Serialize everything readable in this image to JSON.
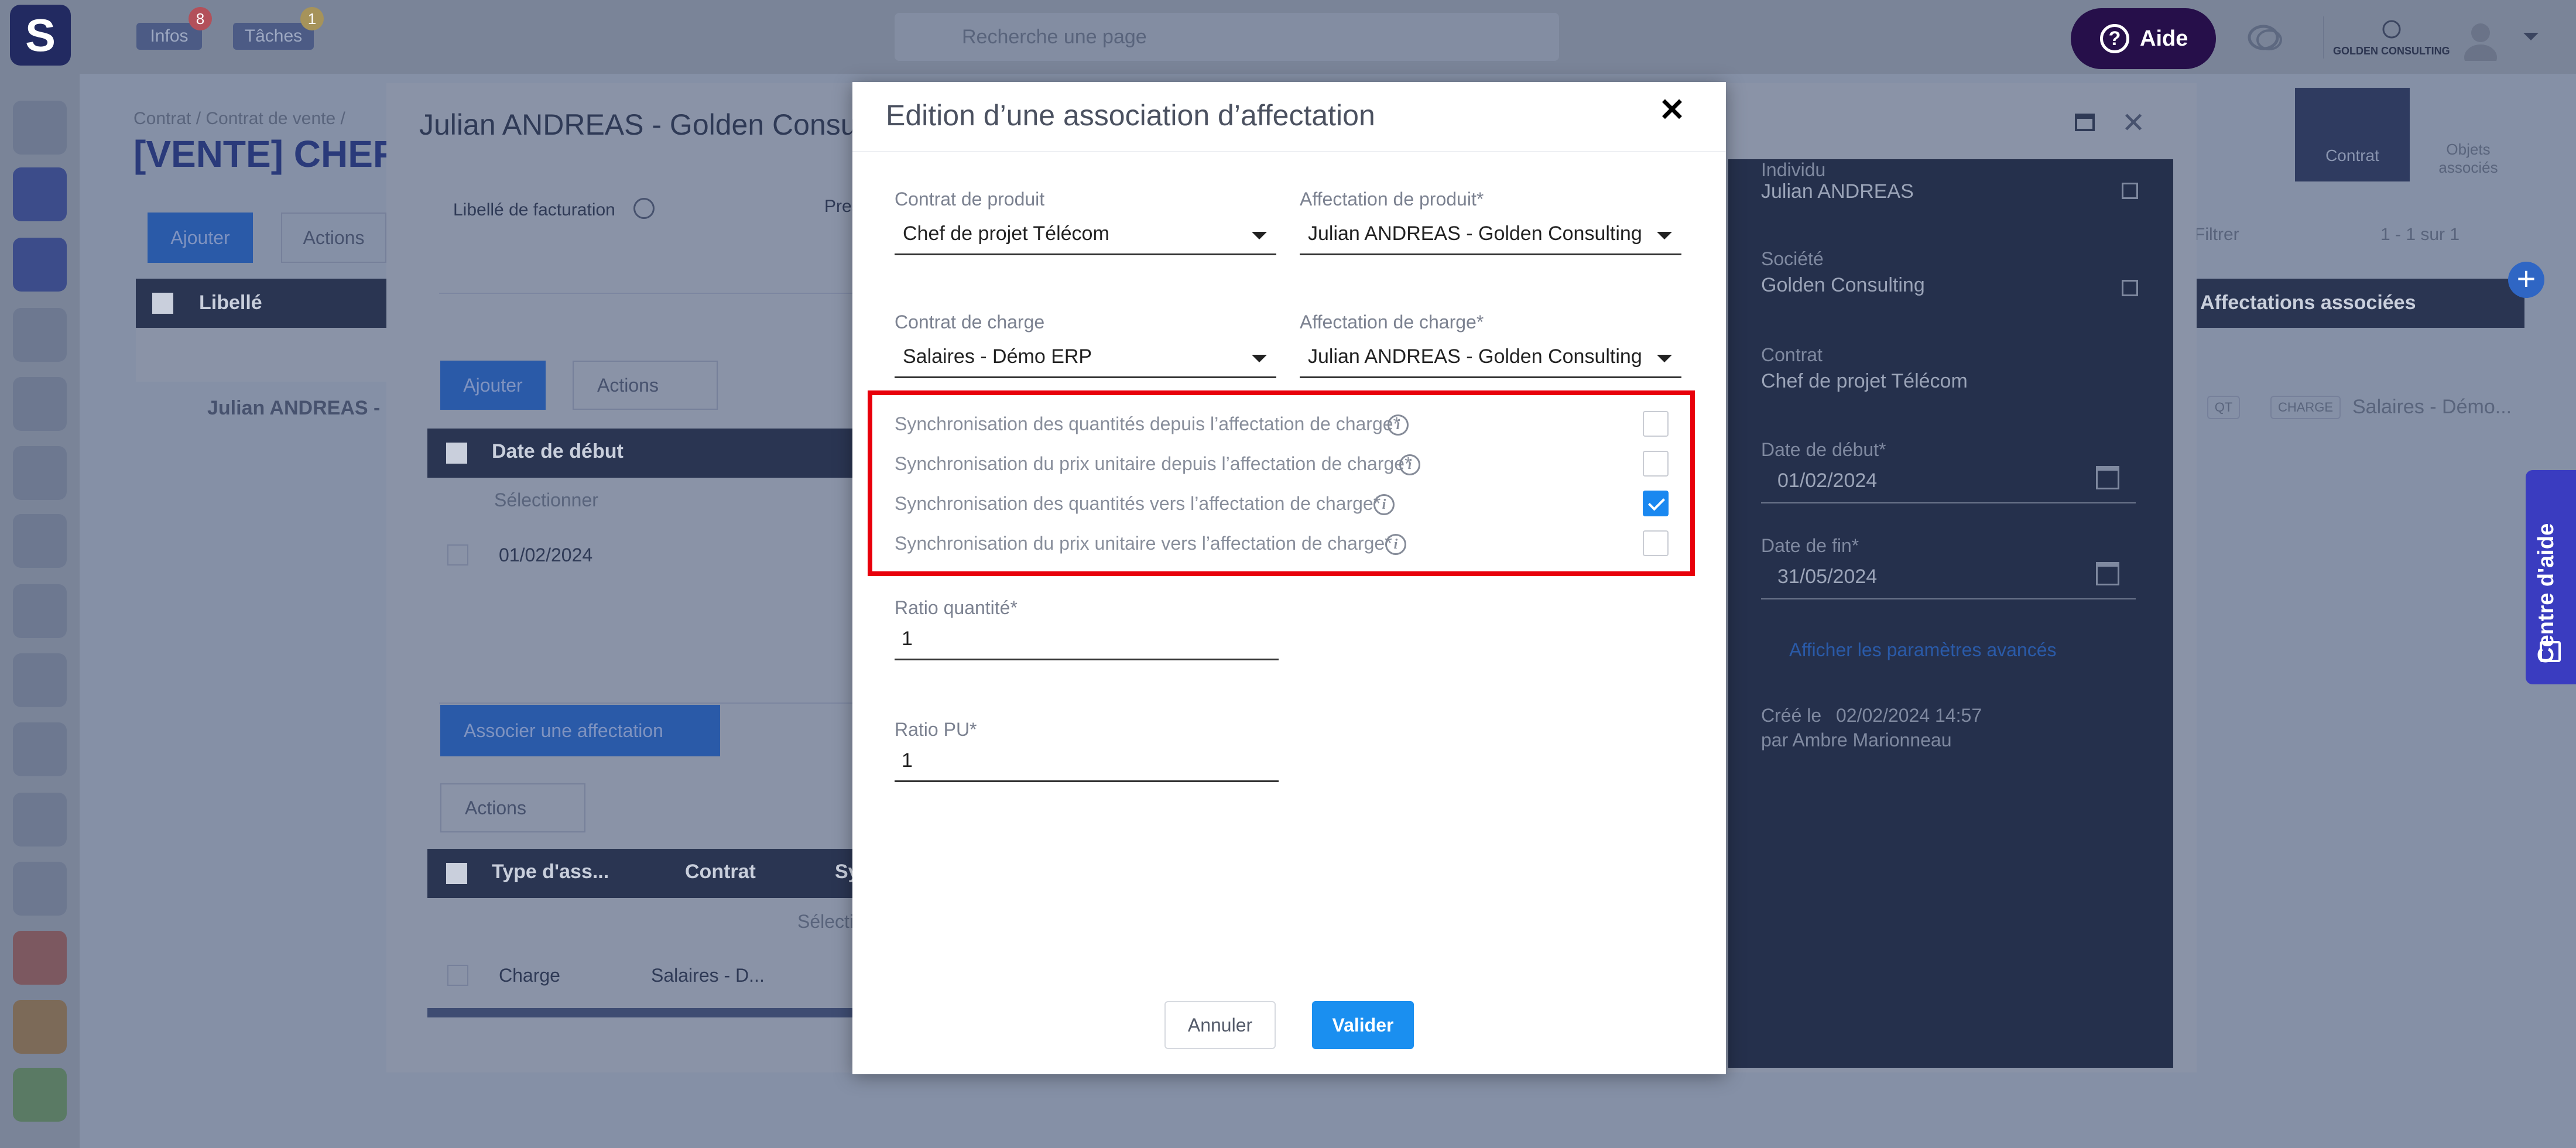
{
  "topbar": {
    "logo": "S",
    "infos_label": "Infos",
    "infos_count": "8",
    "taches_label": "Tâches",
    "taches_count": "1",
    "search_placeholder": "Recherche une page",
    "help_label": "Aide",
    "company": "GOLDEN CONSULTING"
  },
  "background": {
    "breadcrumb": "Contrat  /  Contrat de vente  /",
    "page_title": "[VENTE] CHEF",
    "add_button": "Ajouter",
    "actions_button": "Actions",
    "col_libelle": "Libellé",
    "row_name": "Julian ANDREAS - G",
    "tab_contrat": "Contrat",
    "tab_objets": "Objets associés",
    "filter_label": "Filtrer",
    "pagination": "1 - 1 sur 1",
    "col_affectations": "Affectations associées",
    "row_tags": [
      "QT",
      "CHARGE"
    ],
    "row_affectation": "Salaires - Démo..."
  },
  "panel": {
    "title": "Julian ANDREAS - Golden Consulting",
    "libelle_facturation": "Libellé de facturation",
    "tab_pres": "Pres",
    "add_button": "Ajouter",
    "actions_button": "Actions",
    "col_date_debut": "Date de début",
    "filter_placeholder": "Sélectionner",
    "row_date": "01/02/2024",
    "associer_button": "Associer une affectation",
    "actions_button2": "Actions",
    "col_type": "Type d'ass...",
    "col_contrat": "Contrat",
    "col_synch": "Synch",
    "filter_select": "Sélecti",
    "row_type": "Charge",
    "row_contrat": "Salaires - D...",
    "right": {
      "individu_label": "Individu",
      "individu_value": "Julian ANDREAS",
      "societe_label": "Société",
      "societe_value": "Golden Consulting",
      "contrat_label": "Contrat",
      "contrat_value": "Chef de projet Télécom",
      "date_debut_label": "Date de début*",
      "date_debut_value": "01/02/2024",
      "date_fin_label": "Date de fin*",
      "date_fin_value": "31/05/2024",
      "advanced_link": "Afficher les paramètres avancés",
      "created_label": "Créé le",
      "created_value": "02/02/2024 14:57",
      "created_by": "par Ambre Marionneau"
    }
  },
  "modal": {
    "title": "Edition d’une association d’affectation",
    "contrat_produit_label": "Contrat de produit",
    "contrat_produit_value": "Chef de projet Télécom",
    "affectation_produit_label": "Affectation de produit*",
    "affectation_produit_value": "Julian ANDREAS - Golden Consulting",
    "contrat_charge_label": "Contrat de charge",
    "contrat_charge_value": "Salaires - Démo ERP",
    "affectation_charge_label": "Affectation de charge*",
    "affectation_charge_value": "Julian ANDREAS - Golden Consulting",
    "sync": [
      {
        "label": "Synchronisation des quantités depuis l’affectation de charge*",
        "checked": false
      },
      {
        "label": "Synchronisation du prix unitaire depuis l’affectation de charge*",
        "checked": false
      },
      {
        "label": "Synchronisation des quantités vers l’affectation de charge*",
        "checked": true
      },
      {
        "label": "Synchronisation du prix unitaire vers l’affectation de charge*",
        "checked": false
      }
    ],
    "ratio_quantite_label": "Ratio quantité*",
    "ratio_quantite_value": "1",
    "ratio_pu_label": "Ratio PU*",
    "ratio_pu_value": "1",
    "cancel_button": "Annuler",
    "validate_button": "Valider"
  },
  "help_tab": "Centre d'aide",
  "colors": {
    "accent": "#1a8ff0",
    "highlight": "#e8000b",
    "aide": "#260f4a"
  }
}
